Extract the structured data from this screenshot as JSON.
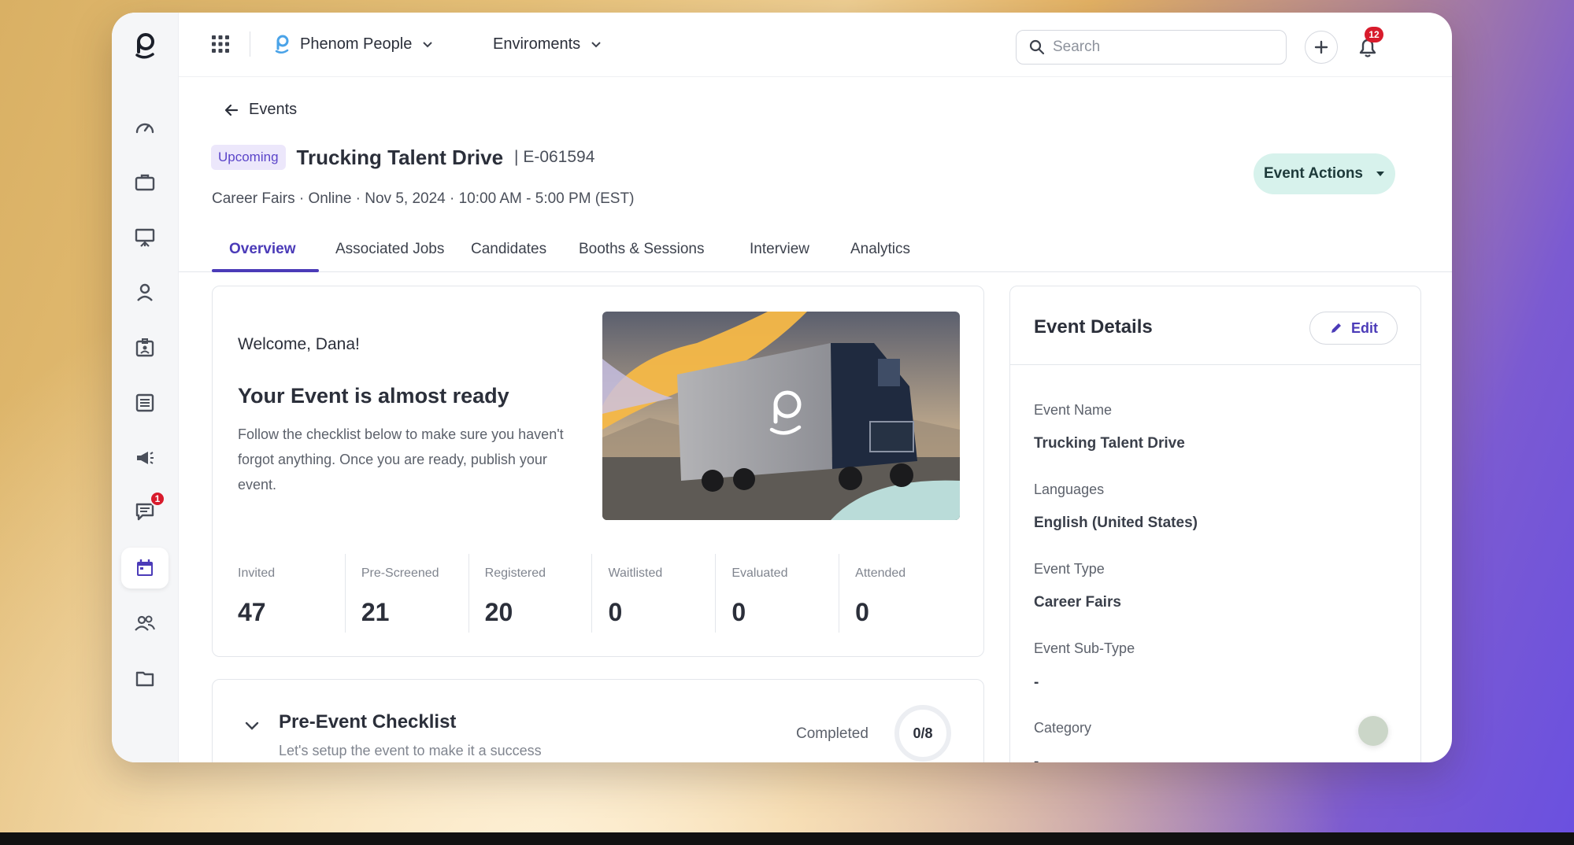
{
  "topbar": {
    "org_name": "Phenom People",
    "env_label": "Enviroments",
    "search_placeholder": "Search",
    "notification_count": "12"
  },
  "sidebar": {
    "items": [
      {
        "icon": "dashboard-icon"
      },
      {
        "icon": "briefcase-icon"
      },
      {
        "icon": "presentation-icon"
      },
      {
        "icon": "person-icon"
      },
      {
        "icon": "id-badge-icon"
      },
      {
        "icon": "list-icon"
      },
      {
        "icon": "megaphone-icon"
      },
      {
        "icon": "chat-icon",
        "badge": "1"
      },
      {
        "icon": "calendar-icon",
        "active": true
      },
      {
        "icon": "people-icon"
      },
      {
        "icon": "folder-icon"
      }
    ]
  },
  "header": {
    "back_label": "Events",
    "status": "Upcoming",
    "title": "Trucking Talent Drive",
    "event_id": "| E-061594",
    "subline": "Career Fairs · Online · Nov 5, 2024 · 10:00 AM - 5:00 PM (EST)",
    "actions_label": "Event Actions"
  },
  "tabs": [
    "Overview",
    "Associated Jobs",
    "Candidates",
    "Booths & Sessions",
    "Interview",
    "Analytics"
  ],
  "welcome": {
    "greeting": "Welcome, Dana!",
    "heading": "Your Event is almost ready",
    "body": "Follow the checklist below to make sure you haven't forgot anything. Once you are ready, publish your event."
  },
  "stats": [
    {
      "label": "Invited",
      "value": "47"
    },
    {
      "label": "Pre-Screened",
      "value": "21"
    },
    {
      "label": "Registered",
      "value": "20"
    },
    {
      "label": "Waitlisted",
      "value": "0"
    },
    {
      "label": "Evaluated",
      "value": "0"
    },
    {
      "label": "Attended",
      "value": "0"
    }
  ],
  "checklist": {
    "title": "Pre-Event Checklist",
    "subtitle": "Let's setup the event to make it a success",
    "completed_label": "Completed",
    "progress": "0/8"
  },
  "details": {
    "title": "Event Details",
    "edit_label": "Edit",
    "fields": [
      {
        "label": "Event Name",
        "value": "Trucking Talent Drive"
      },
      {
        "label": "Languages",
        "value": "English (United States)"
      },
      {
        "label": "Event Type",
        "value": "Career Fairs"
      },
      {
        "label": "Event Sub-Type",
        "value": "-"
      },
      {
        "label": "Category",
        "value": "-"
      }
    ]
  },
  "colors": {
    "accent": "#4b3bb8",
    "pill_bg": "#ece7fb",
    "actions_bg": "#d7f2ec",
    "badge": "#d81b2c"
  }
}
